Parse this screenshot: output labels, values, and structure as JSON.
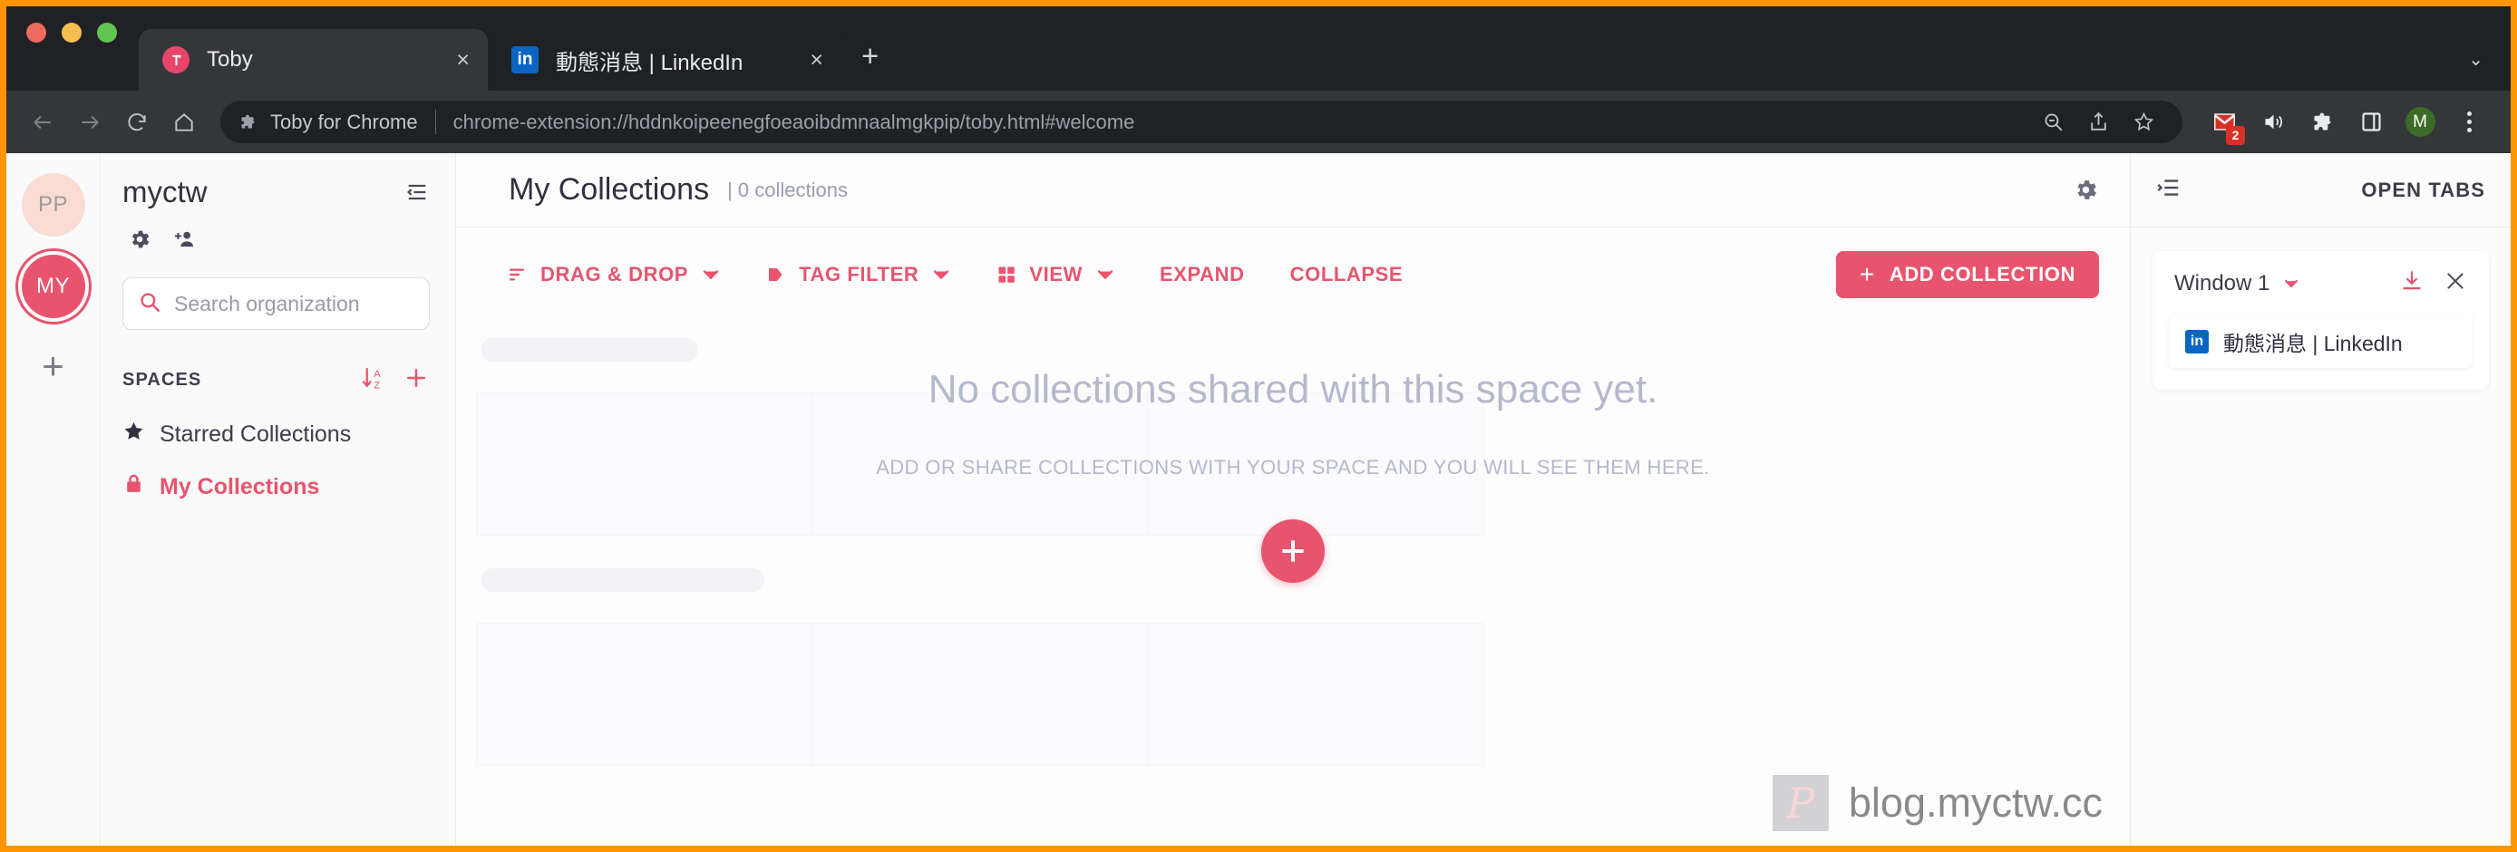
{
  "browser": {
    "tabs": [
      {
        "title": "Toby",
        "favicon": "toby-icon",
        "active": true,
        "close_label": "×"
      },
      {
        "title": "動態消息 | LinkedIn",
        "favicon": "linkedin-icon",
        "active": false,
        "close_label": "×"
      }
    ],
    "new_tab_label": "+",
    "tabstrip_expand_label": "⌄",
    "omnibox": {
      "extension_name": "Toby for Chrome",
      "url": "chrome-extension://hddnkoipeenegfoeaoibdmnaalmgkpip/toby.html#welcome"
    },
    "toolbar_icons": [
      "back-icon",
      "forward-icon",
      "reload-icon",
      "home-icon",
      "zoom-out-icon",
      "share-icon",
      "bookmark-star-icon",
      "gmail-extension-icon",
      "audio-playing-icon",
      "extensions-puzzle-icon",
      "side-panel-icon",
      "profile-avatar",
      "chrome-menu-icon"
    ],
    "gmail_badge": "2",
    "profile_initial": "M"
  },
  "rail": {
    "avatars": [
      {
        "initials": "PP",
        "selected": false
      },
      {
        "initials": "MY",
        "selected": true
      }
    ],
    "add_label": "+"
  },
  "sidebar": {
    "org_name": "myctw",
    "collapse_icon": "collapse-sidebar-icon",
    "tools": [
      "settings-gear-icon",
      "invite-member-icon"
    ],
    "search": {
      "placeholder": "Search organization",
      "value": "",
      "icon": "search-icon"
    },
    "spaces_heading": "SPACES",
    "spaces_actions": [
      "sort-a-z-icon",
      "add-space-icon"
    ],
    "spaces": [
      {
        "label": "Starred Collections",
        "icon": "star-icon",
        "active": false
      },
      {
        "label": "My Collections",
        "icon": "lock-icon",
        "active": true
      }
    ]
  },
  "main": {
    "title": "My Collections",
    "count_label": "| 0 collections",
    "settings_icon": "gear-icon",
    "toolbar": [
      {
        "label": "DRAG & DROP",
        "icon": "sort-lines-icon",
        "chevron": true
      },
      {
        "label": "TAG FILTER",
        "icon": "tag-icon",
        "chevron": true
      },
      {
        "label": "VIEW",
        "icon": "grid-view-icon",
        "chevron": true
      },
      {
        "label": "EXPAND",
        "icon": null,
        "chevron": false
      },
      {
        "label": "COLLAPSE",
        "icon": null,
        "chevron": false
      }
    ],
    "add_collection": {
      "label": "ADD COLLECTION",
      "plus": "+"
    },
    "empty_state": {
      "title": "No collections shared with this space yet.",
      "subtitle": "ADD OR SHARE COLLECTIONS WITH YOUR SPACE AND YOU WILL SEE THEM HERE.",
      "fab_icon": "plus-icon"
    },
    "watermark": {
      "logo_letter": "P",
      "text": "blog.myctw.cc"
    }
  },
  "right_panel": {
    "collapse_icon": "collapse-panel-icon",
    "title": "OPEN TABS",
    "window": {
      "name": "Window 1",
      "chevron_icon": "chevron-down-icon",
      "save_icon": "save-download-icon",
      "close_icon": "close-icon",
      "tabs": [
        {
          "title": "動態消息 | LinkedIn",
          "favicon": "linkedin-icon"
        }
      ]
    }
  },
  "colors": {
    "accent_pink": "#e8546e",
    "chrome_dark": "#202124",
    "chrome_toolbar": "#35363a",
    "window_border_orange": "#ff9500",
    "linkedin_blue": "#0a66c2"
  }
}
